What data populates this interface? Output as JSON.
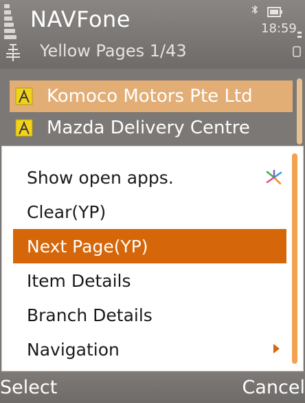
{
  "status_bar": {
    "app_title": "NAVFone",
    "clock": "18:59",
    "subtitle": "Yellow Pages 1/43",
    "icons": [
      "signal-icon",
      "bluetooth-icon",
      "battery-icon",
      "navigation-icon",
      "keylock-icon"
    ]
  },
  "list": {
    "items": [
      {
        "label": "Komoco Motors Pte Ltd",
        "icon": "yellow-pages-icon",
        "selected": true
      },
      {
        "label": "Mazda Delivery Centre",
        "icon": "yellow-pages-icon",
        "selected": false
      }
    ]
  },
  "menu": {
    "items": [
      {
        "label": "Show open apps.",
        "icon": "open-apps-icon",
        "selected": false
      },
      {
        "label": "Clear(YP)",
        "selected": false
      },
      {
        "label": "Next Page(YP)",
        "selected": true
      },
      {
        "label": "Item Details",
        "selected": false
      },
      {
        "label": "Branch Details",
        "selected": false
      },
      {
        "label": "Navigation",
        "icon": "submenu-arrow-icon",
        "selected": false
      }
    ]
  },
  "softkeys": {
    "left": "Select",
    "right": "Cancel"
  },
  "colors": {
    "highlight": "#d5660a",
    "list_highlight": "#e3ae76",
    "background": "#7a7674"
  }
}
